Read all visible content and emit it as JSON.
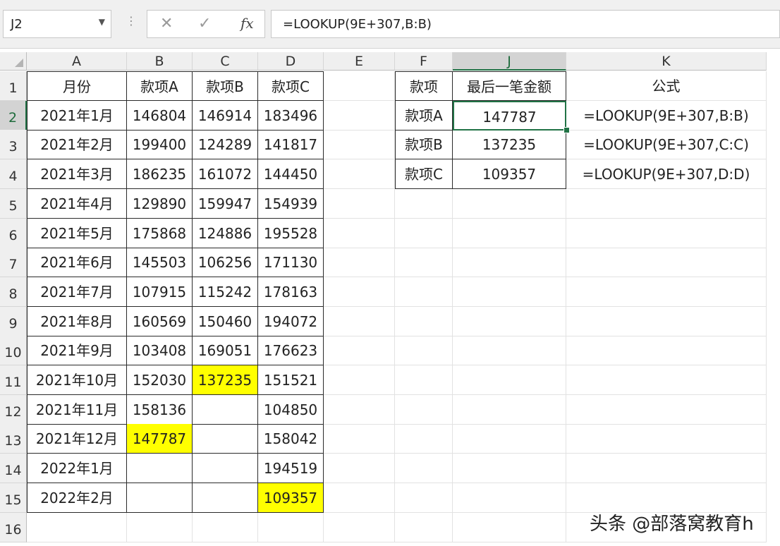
{
  "formula_bar": {
    "name_box": "J2",
    "formula": "=LOOKUP(9E+307,B:B)",
    "cancel_icon": "x-icon",
    "enter_icon": "check-icon",
    "fx_label": "fx"
  },
  "columns": [
    "A",
    "B",
    "C",
    "D",
    "E",
    "F",
    "J",
    "K"
  ],
  "rows": [
    "1",
    "2",
    "3",
    "4",
    "5",
    "6",
    "7",
    "8",
    "9",
    "10",
    "11",
    "12",
    "13",
    "14",
    "15",
    "16"
  ],
  "data_table": {
    "headers": [
      "月份",
      "款项A",
      "款项B",
      "款项C"
    ],
    "rows": [
      [
        "2021年1月",
        "146804",
        "146914",
        "183496"
      ],
      [
        "2021年2月",
        "199400",
        "124289",
        "141817"
      ],
      [
        "2021年3月",
        "186235",
        "161072",
        "144450"
      ],
      [
        "2021年4月",
        "129890",
        "159947",
        "154939"
      ],
      [
        "2021年5月",
        "175868",
        "124886",
        "195528"
      ],
      [
        "2021年6月",
        "145503",
        "106256",
        "171130"
      ],
      [
        "2021年7月",
        "107915",
        "115242",
        "178163"
      ],
      [
        "2021年8月",
        "160569",
        "150460",
        "194072"
      ],
      [
        "2021年9月",
        "103408",
        "169051",
        "176623"
      ],
      [
        "2021年10月",
        "152030",
        "137235",
        "151521"
      ],
      [
        "2021年11月",
        "158136",
        "",
        "104850"
      ],
      [
        "2021年12月",
        "147787",
        "",
        "158042"
      ],
      [
        "2022年1月",
        "",
        "",
        "194519"
      ],
      [
        "2022年2月",
        "",
        "",
        "109357"
      ]
    ],
    "highlighted_cells": [
      "B13",
      "C11",
      "D15"
    ],
    "highlight_color": "#ffff00"
  },
  "summary_table": {
    "headers": [
      "款项",
      "最后一笔金额"
    ],
    "rows": [
      [
        "款项A",
        "147787"
      ],
      [
        "款项B",
        "137235"
      ],
      [
        "款项C",
        "109357"
      ]
    ]
  },
  "formulas_header": "公式",
  "formulas": [
    "=LOOKUP(9E+307,B:B)",
    "=LOOKUP(9E+307,C:C)",
    "=LOOKUP(9E+307,D:D)"
  ],
  "active_cell": "J2",
  "selection_color": "#217346",
  "watermark": "头条 @部落窝教育h"
}
